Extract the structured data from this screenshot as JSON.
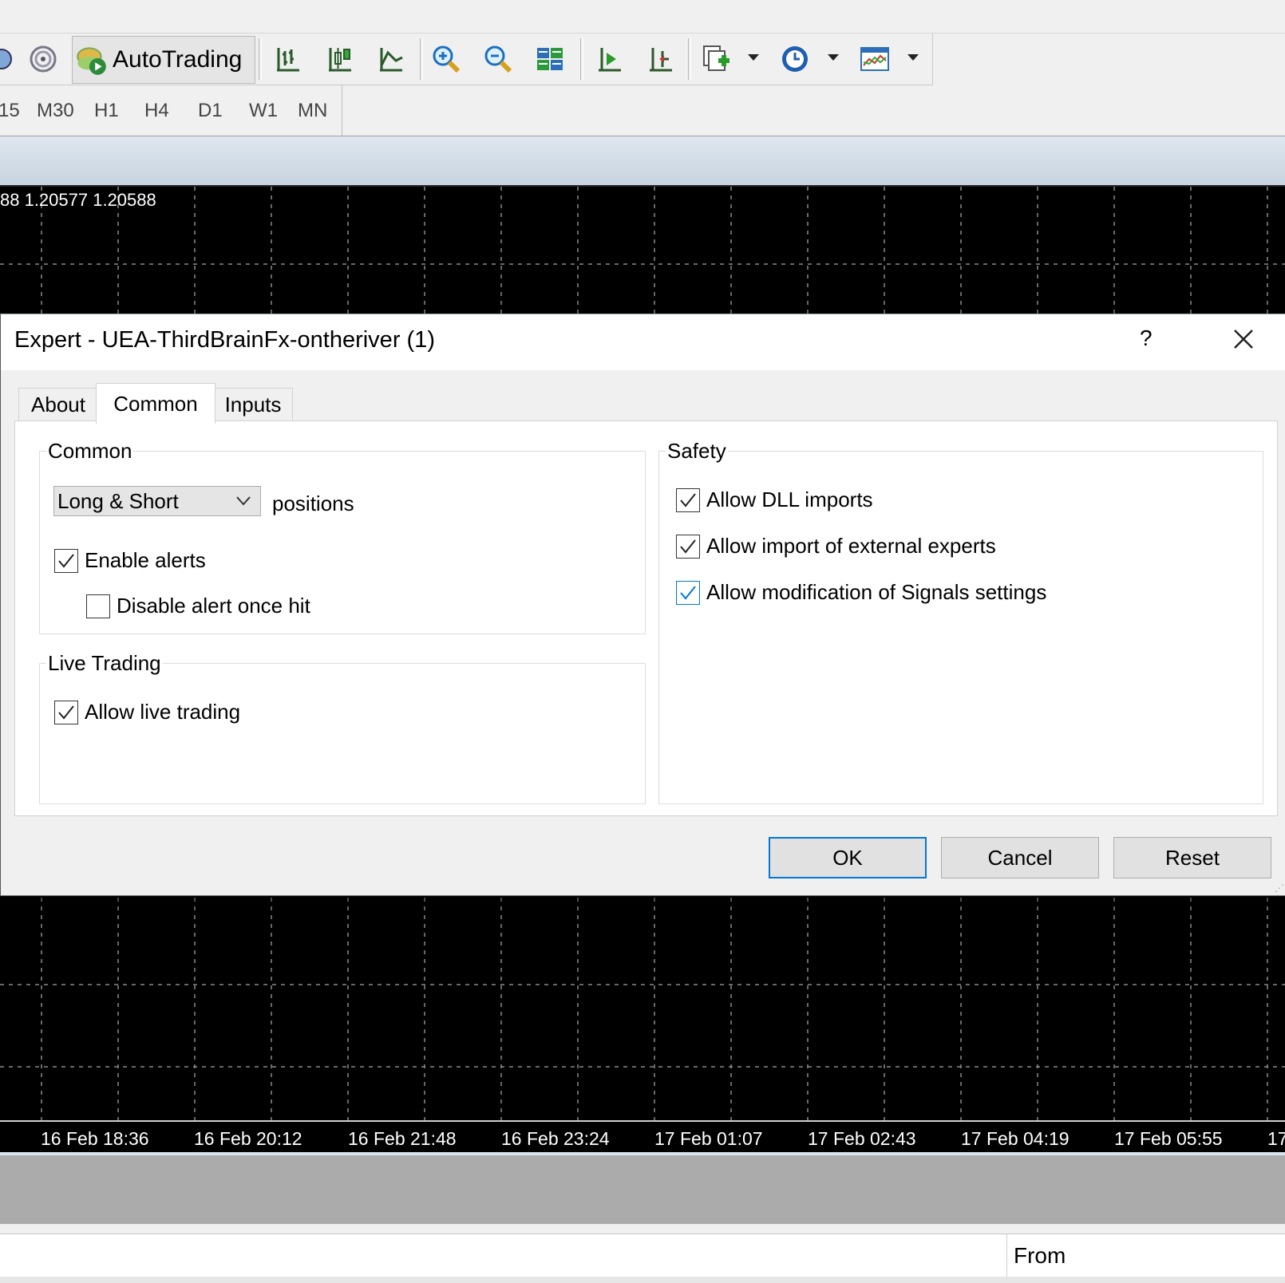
{
  "toolbar": {
    "autotrading_label": "AutoTrading",
    "timeframes": [
      "15",
      "M30",
      "H1",
      "H4",
      "D1",
      "W1",
      "MN"
    ]
  },
  "chart": {
    "price_line": "88 1.20577 1.20588",
    "time_labels": [
      "16 Feb 18:36",
      "16 Feb 20:12",
      "16 Feb 21:48",
      "16 Feb 23:24",
      "17 Feb 01:07",
      "17 Feb 02:43",
      "17 Feb 04:19",
      "17 Feb 05:55",
      "17"
    ]
  },
  "bottom": {
    "from_label": "From"
  },
  "dialog": {
    "title": "Expert - UEA-ThirdBrainFx-ontheriver (1)",
    "help": "?",
    "tabs": [
      "About",
      "Common",
      "Inputs"
    ],
    "active_tab": "Common",
    "common_group": {
      "title": "Common",
      "positions_select": "Long & Short",
      "positions_label": "positions",
      "enable_alerts": {
        "label": "Enable alerts",
        "checked": true
      },
      "disable_alert_once_hit": {
        "label": "Disable alert once hit",
        "checked": false
      }
    },
    "live_trading_group": {
      "title": "Live Trading",
      "allow_live_trading": {
        "label": "Allow live trading",
        "checked": true
      }
    },
    "safety_group": {
      "title": "Safety",
      "allow_dll_imports": {
        "label": "Allow DLL imports",
        "checked": true
      },
      "allow_import_external_experts": {
        "label": "Allow import of external experts",
        "checked": true
      },
      "allow_modification_signals": {
        "label": "Allow modification of Signals settings",
        "checked": true
      }
    },
    "buttons": {
      "ok": "OK",
      "cancel": "Cancel",
      "reset": "Reset"
    }
  },
  "colors": {
    "accent": "#0078d7",
    "chart_bg": "#000000",
    "dialog_bg": "#f0f0f0"
  }
}
